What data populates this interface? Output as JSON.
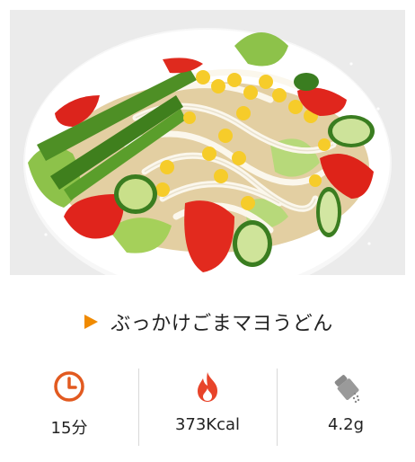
{
  "recipe": {
    "title": "ぶっかけごまマヨうどん",
    "photo_alt": "udon salad bowl"
  },
  "stats": {
    "time": {
      "icon": "clock-icon",
      "value": "15分"
    },
    "calories": {
      "icon": "flame-icon",
      "value": "373Kcal"
    },
    "salt": {
      "icon": "salt-shaker-icon",
      "value": "4.2g"
    }
  },
  "colors": {
    "accent": "#f08a00",
    "clock": "#e25a20",
    "flame": "#e8442a",
    "shaker": "#8a8a8a"
  }
}
